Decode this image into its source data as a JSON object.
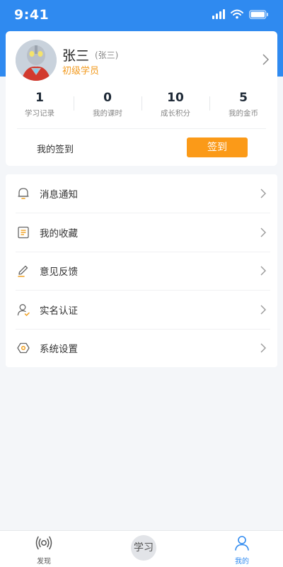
{
  "status_bar": {
    "time": "9:41"
  },
  "profile": {
    "name": "张三",
    "sub_name": "(张三)",
    "level": "初级学员"
  },
  "stats": [
    {
      "value": "1",
      "label": "学习记录"
    },
    {
      "value": "0",
      "label": "我的课时"
    },
    {
      "value": "10",
      "label": "成长积分"
    },
    {
      "value": "5",
      "label": "我的金币"
    }
  ],
  "checkin": {
    "label": "我的签到",
    "button_label": "签到"
  },
  "menu": [
    {
      "label": "消息通知",
      "icon": "bell-icon"
    },
    {
      "label": "我的收藏",
      "icon": "document-icon"
    },
    {
      "label": "意见反馈",
      "icon": "pencil-icon"
    },
    {
      "label": "实名认证",
      "icon": "user-check-icon"
    },
    {
      "label": "系统设置",
      "icon": "hexagon-settings-icon"
    }
  ],
  "tabs": [
    {
      "label": "发现",
      "icon": "broadcast-icon"
    },
    {
      "label": "学习",
      "icon": "study-circle"
    },
    {
      "label": "我的",
      "icon": "person-icon",
      "active": true
    }
  ],
  "colors": {
    "header_blue": "#2f8af0",
    "accent_orange": "#fb9a18",
    "level_orange": "#f29a1f"
  }
}
